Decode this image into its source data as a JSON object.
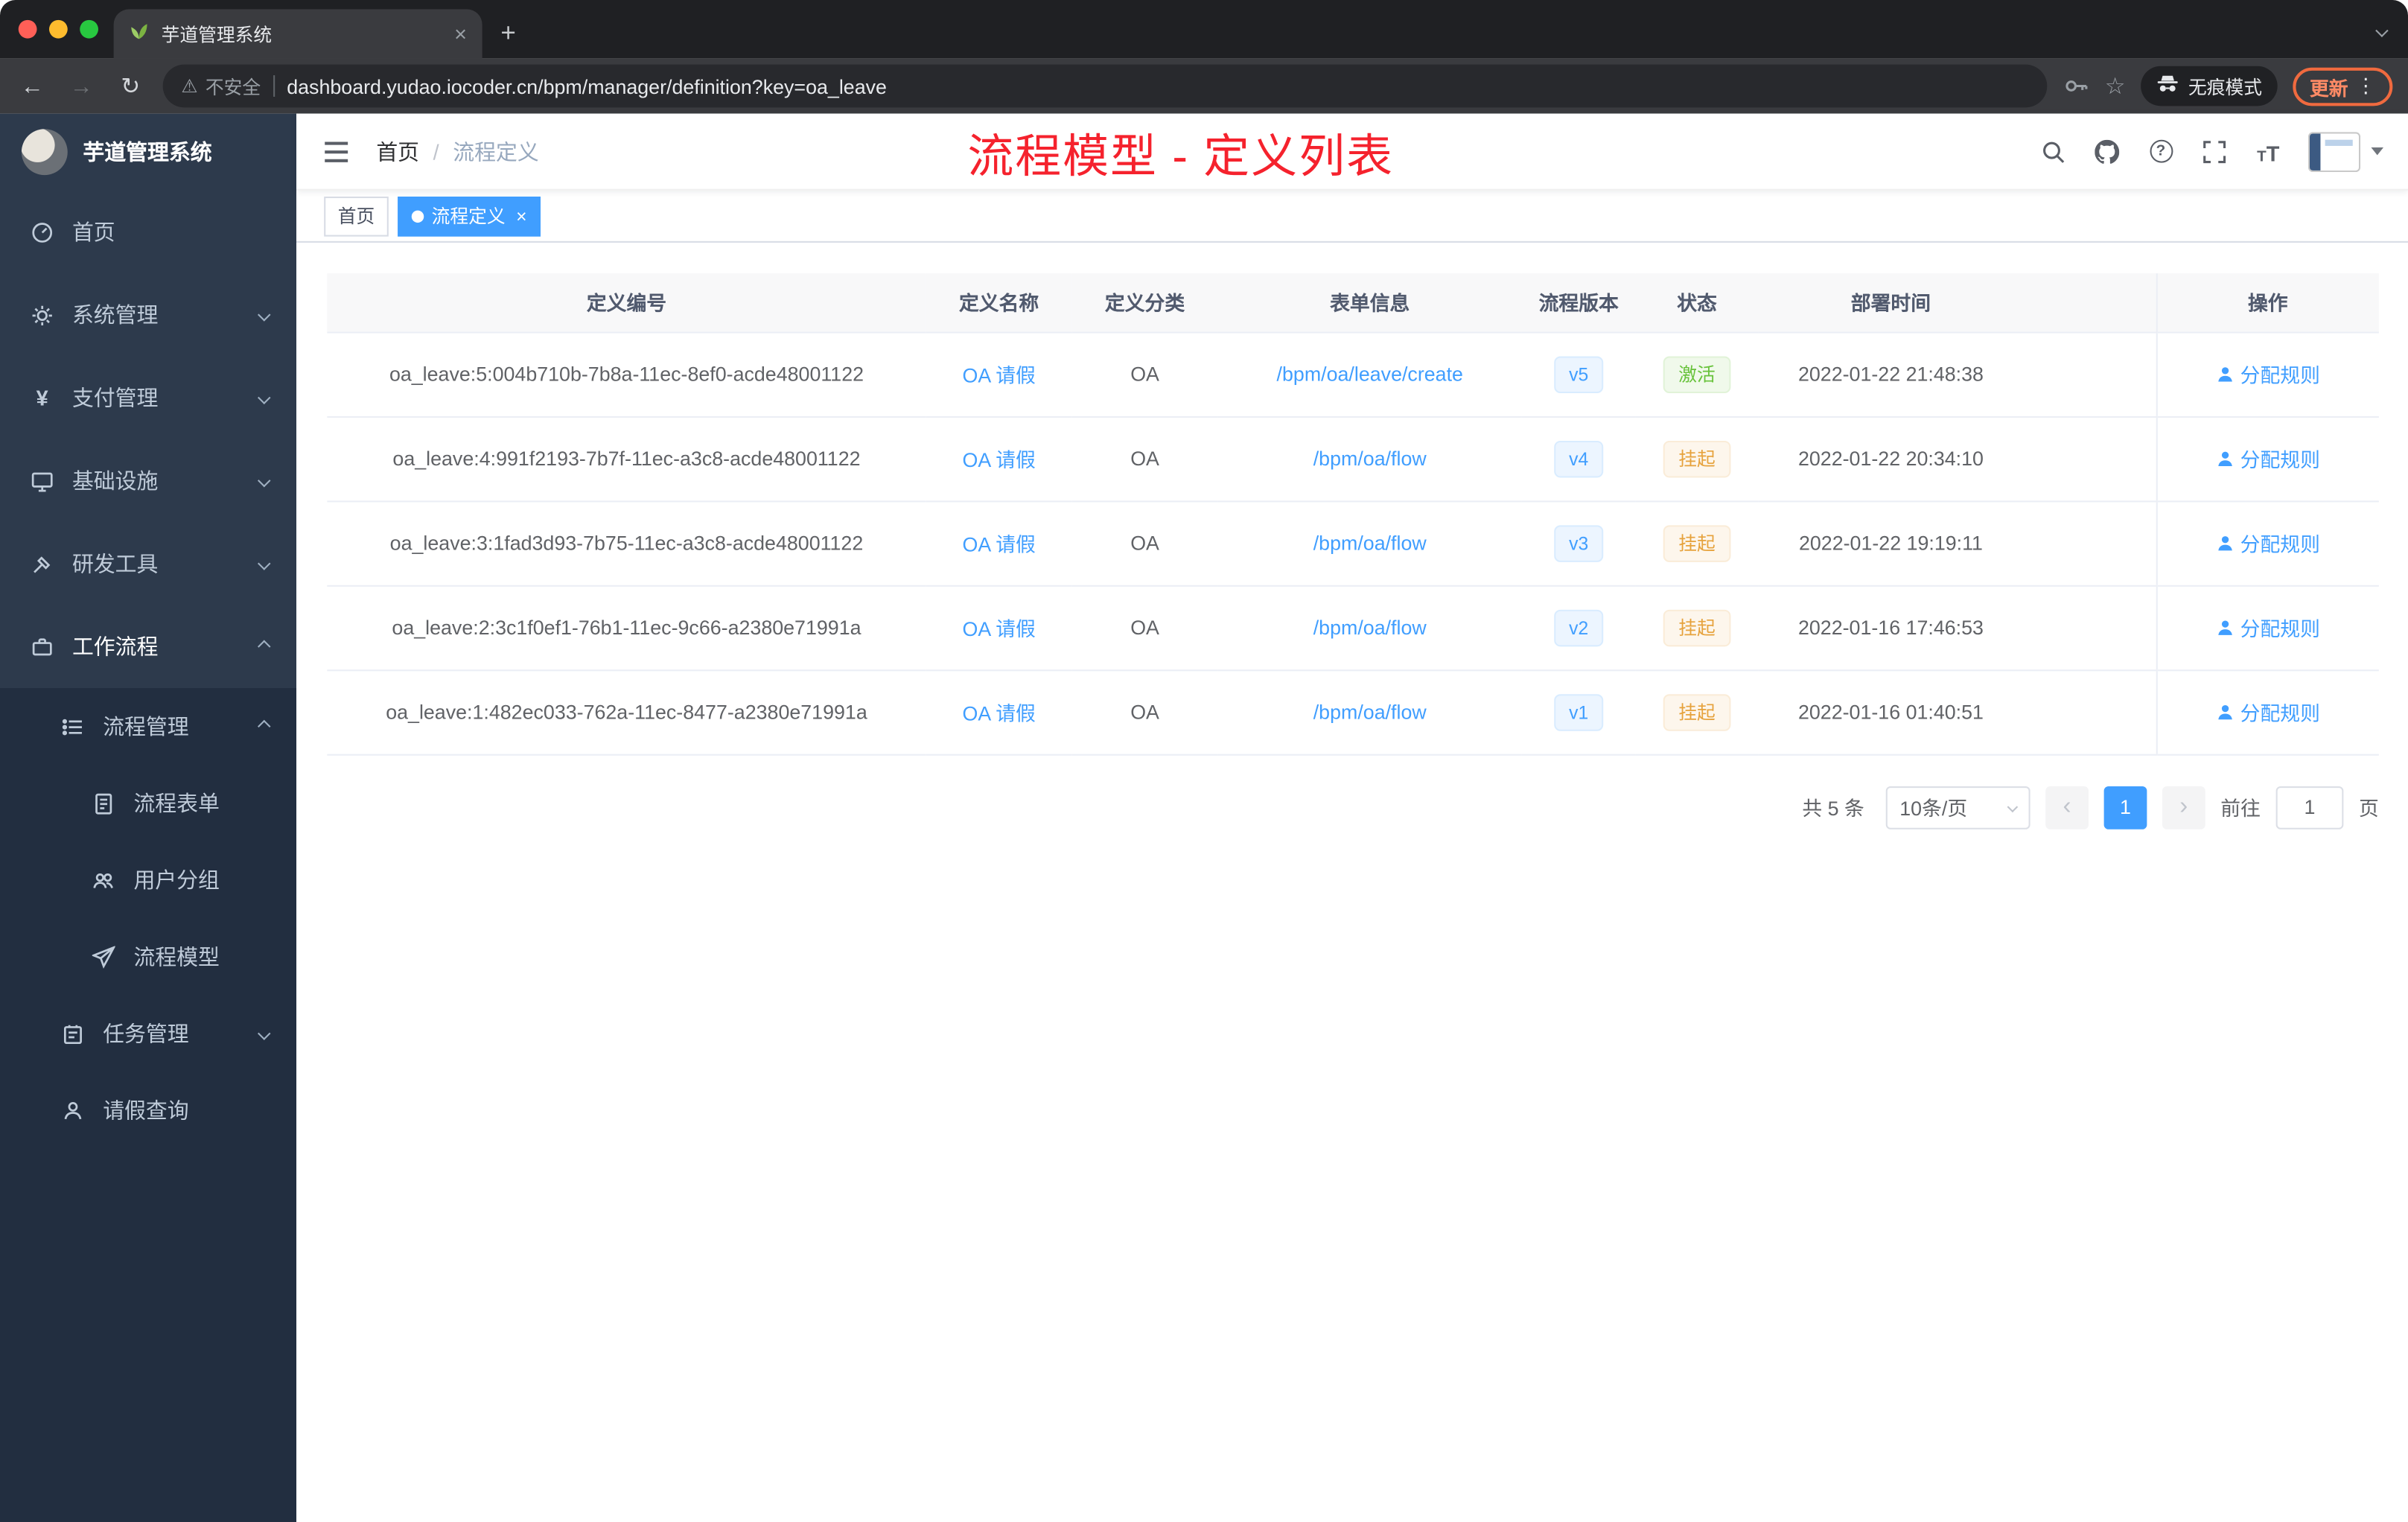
{
  "colors": {
    "accent": "#409eff",
    "annotation_red": "#f5222d",
    "sidebar_bg": "#2d3a4c",
    "submenu_bg": "#222e40",
    "status_active_green": "#67c23a",
    "status_suspend_orange": "#e6a23c"
  },
  "icons": {
    "close": "×",
    "plus": "+",
    "back": "←",
    "forward": "→",
    "reload": "↻",
    "warning": "⚠",
    "star": "☆",
    "menu_dots": "⋮",
    "question": "?",
    "prev": "‹",
    "next": "›",
    "yen": "¥"
  },
  "browser": {
    "tab_title": "芋道管理系统",
    "security_label": "不安全",
    "url": "dashboard.yudao.iocoder.cn/bpm/manager/definition?key=oa_leave",
    "incognito_label": "无痕模式",
    "update_label": "更新"
  },
  "sidebar": {
    "logo_title": "芋道管理系统",
    "items": [
      {
        "label": "首页"
      },
      {
        "label": "系统管理"
      },
      {
        "label": "支付管理"
      },
      {
        "label": "基础设施"
      },
      {
        "label": "研发工具"
      },
      {
        "label": "工作流程"
      },
      {
        "label": "流程管理"
      },
      {
        "label": "流程表单"
      },
      {
        "label": "用户分组"
      },
      {
        "label": "流程模型"
      },
      {
        "label": "任务管理"
      },
      {
        "label": "请假查询"
      }
    ]
  },
  "navbar": {
    "breadcrumb_home": "首页",
    "separator": "/",
    "breadcrumb_current": "流程定义",
    "annotation": "流程模型 - 定义列表"
  },
  "tags": {
    "home": "首页",
    "active": "流程定义"
  },
  "table": {
    "columns": [
      "定义编号",
      "定义名称",
      "定义分类",
      "表单信息",
      "流程版本",
      "状态",
      "部署时间",
      "操作"
    ],
    "rows": [
      {
        "id": "oa_leave:5:004b710b-7b8a-11ec-8ef0-acde48001122",
        "name": "OA 请假",
        "category": "OA",
        "form": "/bpm/oa/leave/create",
        "version": "v5",
        "status": "激活",
        "time": "2022-01-22 21:48:38",
        "action": "分配规则"
      },
      {
        "id": "oa_leave:4:991f2193-7b7f-11ec-a3c8-acde48001122",
        "name": "OA 请假",
        "category": "OA",
        "form": "/bpm/oa/flow",
        "version": "v4",
        "status": "挂起",
        "time": "2022-01-22 20:34:10",
        "action": "分配规则"
      },
      {
        "id": "oa_leave:3:1fad3d93-7b75-11ec-a3c8-acde48001122",
        "name": "OA 请假",
        "category": "OA",
        "form": "/bpm/oa/flow",
        "version": "v3",
        "status": "挂起",
        "time": "2022-01-22 19:19:11",
        "action": "分配规则"
      },
      {
        "id": "oa_leave:2:3c1f0ef1-76b1-11ec-9c66-a2380e71991a",
        "name": "OA 请假",
        "category": "OA",
        "form": "/bpm/oa/flow",
        "version": "v2",
        "status": "挂起",
        "time": "2022-01-16 17:46:53",
        "action": "分配规则"
      },
      {
        "id": "oa_leave:1:482ec033-762a-11ec-8477-a2380e71991a",
        "name": "OA 请假",
        "category": "OA",
        "form": "/bpm/oa/flow",
        "version": "v1",
        "status": "挂起",
        "time": "2022-01-16 01:40:51",
        "action": "分配规则"
      }
    ]
  },
  "pagination": {
    "total": "共 5 条",
    "page_size": "10条/页",
    "current_page": "1",
    "goto_label": "前往",
    "goto_value": "1",
    "page_unit": "页"
  }
}
